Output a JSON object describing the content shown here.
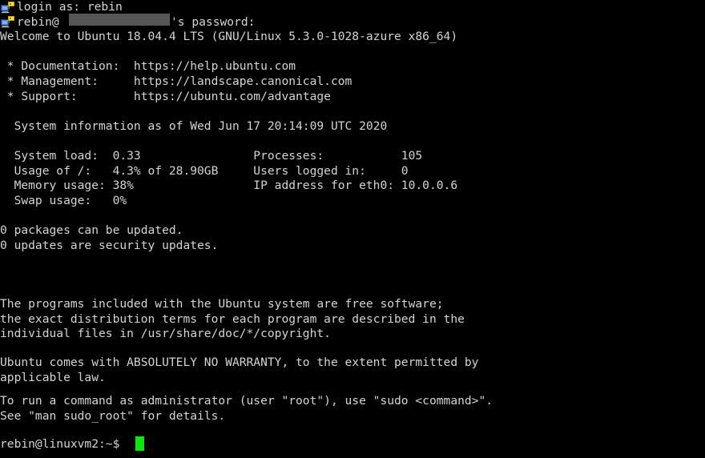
{
  "terminal": {
    "app": "putty-ssh-session",
    "background_color": "#000000",
    "foreground_color": "#d4d4d4",
    "cursor_color": "#0ae80a",
    "redaction_color": "#565656",
    "icon_name": "network-computer-icon",
    "login_prompt": "login as: rebin",
    "password_prompt_prefix": "rebin@",
    "password_prompt_suffix": "'s password:",
    "welcome": "Welcome to Ubuntu 18.04.4 LTS (GNU/Linux 5.3.0-1028-azure x86_64)",
    "links": [
      " * Documentation:  https://help.ubuntu.com",
      " * Management:     https://landscape.canonical.com",
      " * Support:        https://ubuntu.com/advantage"
    ],
    "sysinfo_header": "  System information as of Wed Jun 17 20:14:09 UTC 2020",
    "sysinfo_rows": [
      "  System load:  0.33                Processes:           105",
      "  Usage of /:   4.3% of 28.90GB     Users logged in:     0",
      "  Memory usage: 38%                 IP address for eth0: 10.0.0.6",
      "  Swap usage:   0%"
    ],
    "updates": [
      "0 packages can be updated.",
      "0 updates are security updates."
    ],
    "legal": [
      "The programs included with the Ubuntu system are free software;",
      "the exact distribution terms for each program are described in the",
      "individual files in /usr/share/doc/*/copyright."
    ],
    "warranty": [
      "Ubuntu comes with ABSOLUTELY NO WARRANTY, to the extent permitted by",
      "applicable law."
    ],
    "sudo_help": [
      "To run a command as administrator (user \"root\"), use \"sudo <command>\".",
      "See \"man sudo_root\" for details."
    ],
    "shell_prompt": "rebin@linuxvm2:~$"
  },
  "sysinfo_fields": {
    "system_load": "0.33",
    "usage_of_root": "4.3% of 28.90GB",
    "memory_usage": "38%",
    "swap_usage": "0%",
    "processes": "105",
    "users_logged_in": "0",
    "ip_address_eth0": "10.0.0.6",
    "timestamp": "Wed Jun 17 20:14:09 UTC 2020"
  },
  "os": {
    "distro": "Ubuntu 18.04.4 LTS",
    "kernel": "GNU/Linux 5.3.0-1028-azure x86_64"
  },
  "user": {
    "username": "rebin",
    "hostname": "linuxvm2"
  }
}
